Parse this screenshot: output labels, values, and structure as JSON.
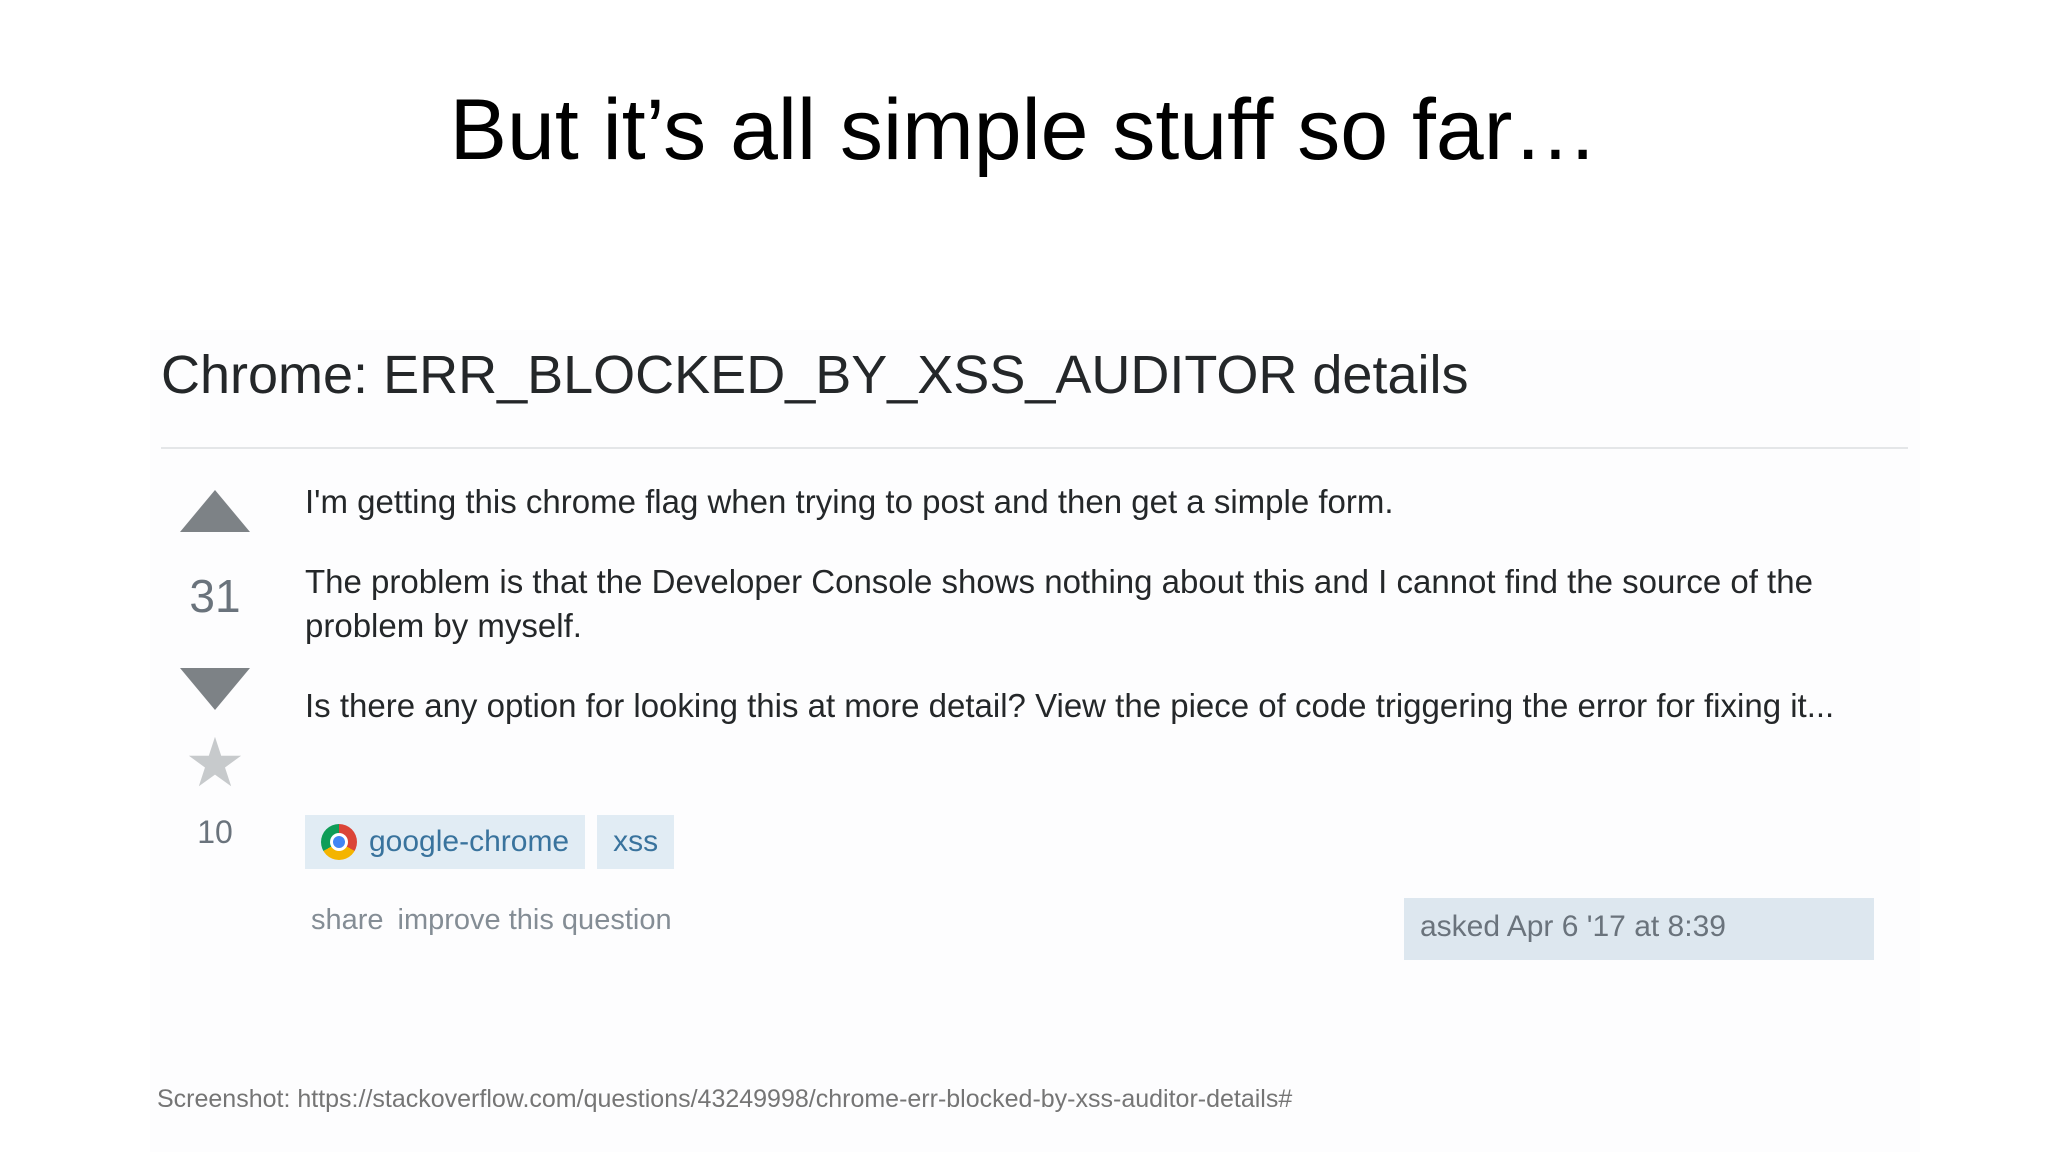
{
  "slide": {
    "title": "But it’s all simple stuff so far…"
  },
  "question": {
    "title": "Chrome: ERR_BLOCKED_BY_XSS_AUDITOR details",
    "votes": "31",
    "favorites": "10",
    "paragraphs": [
      "I'm getting this chrome flag when trying to post and then get a simple form.",
      "The problem is that the Developer Console shows nothing about this and I cannot find the source of the problem by myself.",
      "Is there any option for looking this at more detail? View the piece of code triggering the error for fixing it..."
    ],
    "tags": [
      {
        "label": "google-chrome",
        "icon": "chrome-icon"
      },
      {
        "label": "xss"
      }
    ],
    "menu": {
      "share": "share",
      "improve": "improve this question"
    },
    "asked": "asked Apr 6 '17 at 8:39",
    "colors": {
      "tag_bg": "#e1ecf4",
      "tag_text": "#39739d",
      "asked_bg": "#dde7ef",
      "arrow": "#7d8286"
    }
  },
  "caption": "Screenshot: https://stackoverflow.com/questions/43249998/chrome-err-blocked-by-xss-auditor-details#"
}
